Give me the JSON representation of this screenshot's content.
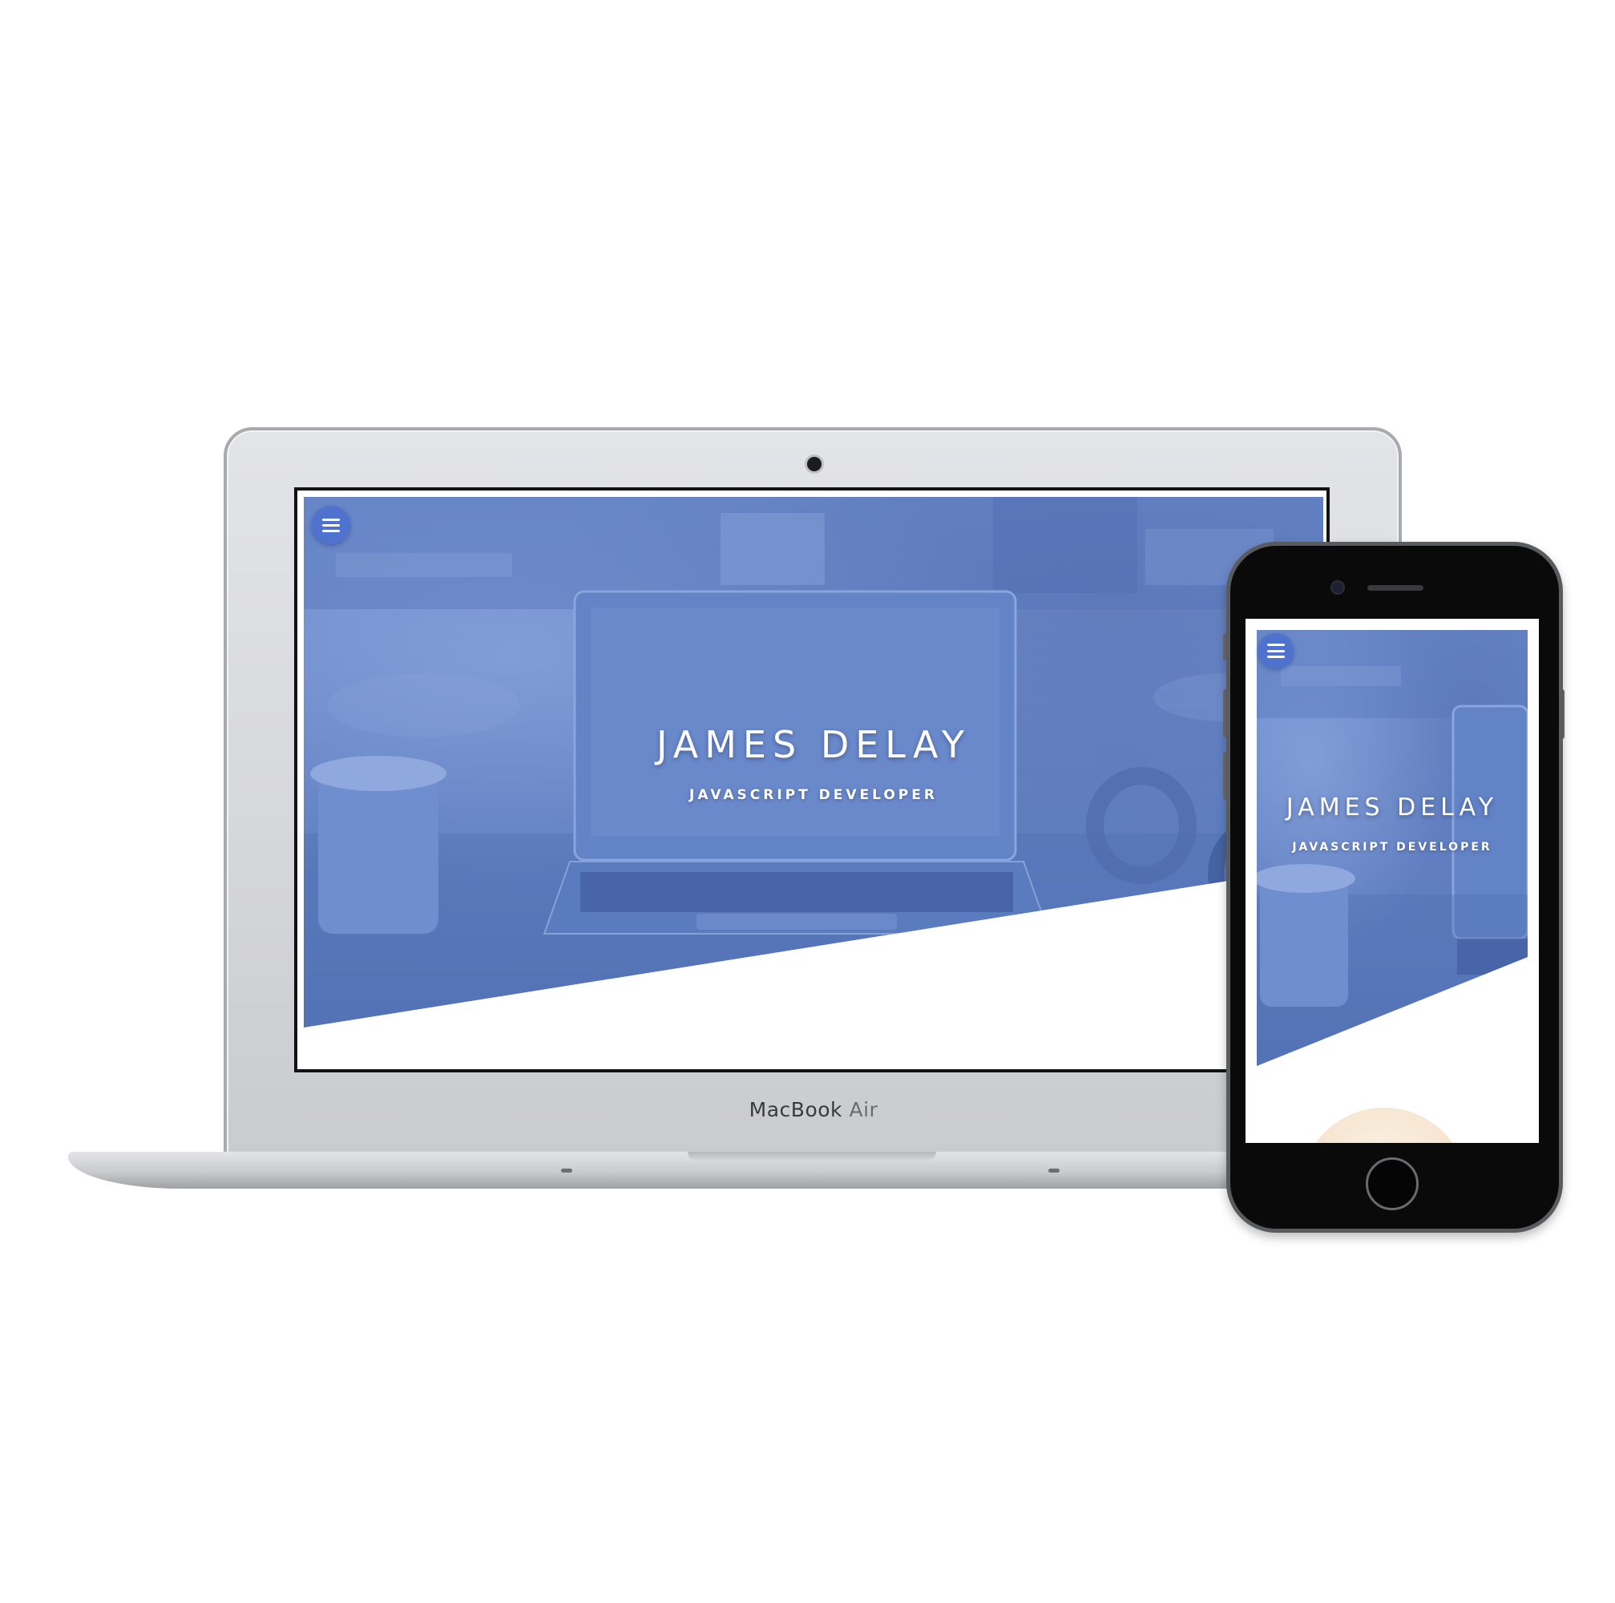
{
  "laptop": {
    "brand_main": "MacBook",
    "brand_suffix": "Air",
    "site": {
      "title": "JAMES DELAY",
      "subtitle": "JAVASCRIPT DEVELOPER",
      "menu_icon": "hamburger-menu-icon"
    }
  },
  "phone": {
    "site": {
      "title": "JAMES DELAY",
      "subtitle": "JAVASCRIPT DEVELOPER",
      "menu_icon": "hamburger-menu-icon"
    }
  },
  "colors": {
    "hero_overlay": "#6585c8",
    "menu_button": "#4f72cf",
    "page_background": "#ffffff"
  }
}
